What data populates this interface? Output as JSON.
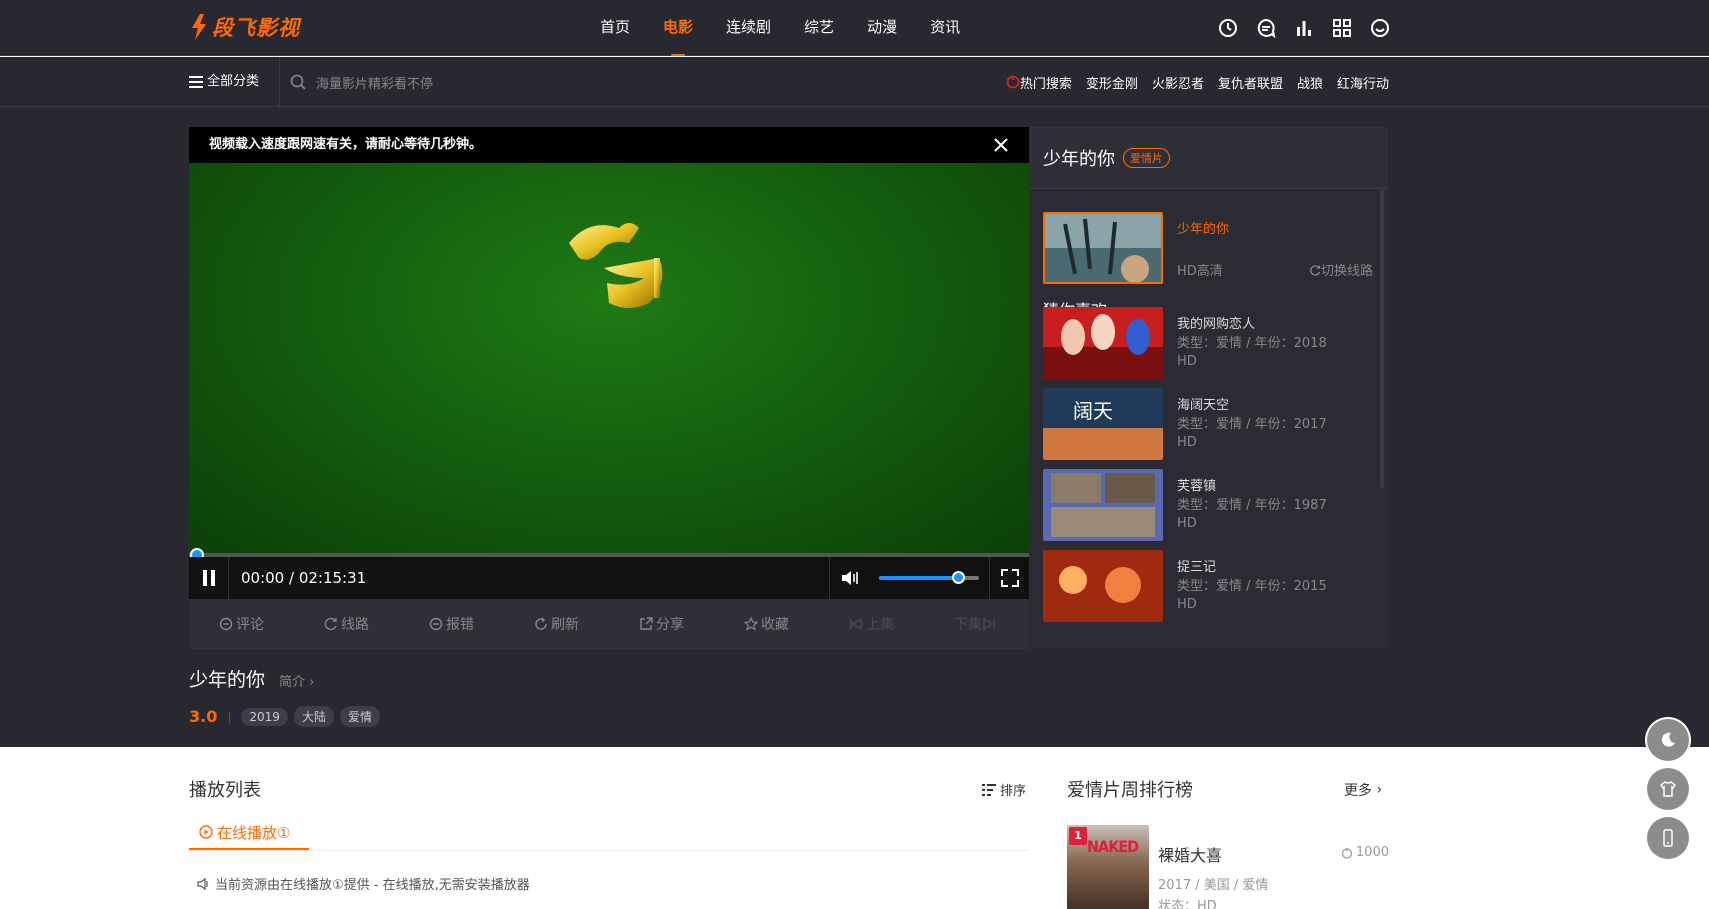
{
  "brand": {
    "name": "段飞影视",
    "accent": "#ff6a00"
  },
  "nav": {
    "items": [
      {
        "label": "首页"
      },
      {
        "label": "电影",
        "active": true
      },
      {
        "label": "连续剧"
      },
      {
        "label": "综艺"
      },
      {
        "label": "动漫"
      },
      {
        "label": "资讯"
      }
    ],
    "icons": [
      "history-icon",
      "message-icon",
      "ranking-icon",
      "grid-icon",
      "user-icon"
    ]
  },
  "subnav": {
    "all_categories": "全部分类",
    "search_placeholder": "海量影片精彩看不停",
    "hot_label": "热门搜索",
    "hot_items": [
      "变形金刚",
      "火影忍者",
      "复仇者联盟",
      "战狼",
      "红海行动"
    ]
  },
  "player": {
    "notice": "视频载入速度跟网速有关，请耐心等待几秒钟。",
    "time": "00:00 / 02:15:31",
    "progress": 0,
    "volume": 0.8
  },
  "actions": [
    {
      "label": "评论",
      "icon": "comment-icon"
    },
    {
      "label": "线路",
      "icon": "route-icon"
    },
    {
      "label": "报错",
      "icon": "report-icon"
    },
    {
      "label": "刷新",
      "icon": "refresh-icon"
    },
    {
      "label": "分享",
      "icon": "share-icon"
    },
    {
      "label": "收藏",
      "icon": "star-icon"
    },
    {
      "label": "上集",
      "icon": "prev-icon",
      "disabled": true
    },
    {
      "label": "下集",
      "icon": "next-icon",
      "disabled": true
    }
  ],
  "movie": {
    "title": "少年的你",
    "intro_link": "简介",
    "score": "3.0",
    "tags": [
      "2019",
      "大陆",
      "爱情"
    ]
  },
  "side": {
    "title": "少年的你",
    "badge": "爱情片",
    "current": {
      "name": "少年的你",
      "quality": "HD高清",
      "switch": "切换线路"
    },
    "guess_title": "猜你喜欢",
    "recs": [
      {
        "name": "我的网购恋人",
        "meta": "类型：爱情 / 年份：2018",
        "quality": "HD"
      },
      {
        "name": "海阔天空",
        "meta": "类型：爱情 / 年份：2017",
        "quality": "HD"
      },
      {
        "name": "芙蓉镇",
        "meta": "类型：爱情 / 年份：1987",
        "quality": "HD"
      },
      {
        "name": "捉三记",
        "meta": "类型：爱情 / 年份：2015",
        "quality": "HD"
      }
    ]
  },
  "playlist": {
    "title": "播放列表",
    "sort": "排序",
    "tab": "在线播放①",
    "source_note": "当前资源由在线播放①提供 - 在线播放,无需安装播放器"
  },
  "ranking": {
    "title": "爱情片周排行榜",
    "more": "更多",
    "items": [
      {
        "rank": "1",
        "name": "裸婚大喜",
        "hits": "1000",
        "meta": "2017 / 美国 / 爱情",
        "status": "状态：HD",
        "poster_text": "NAKED"
      }
    ]
  }
}
